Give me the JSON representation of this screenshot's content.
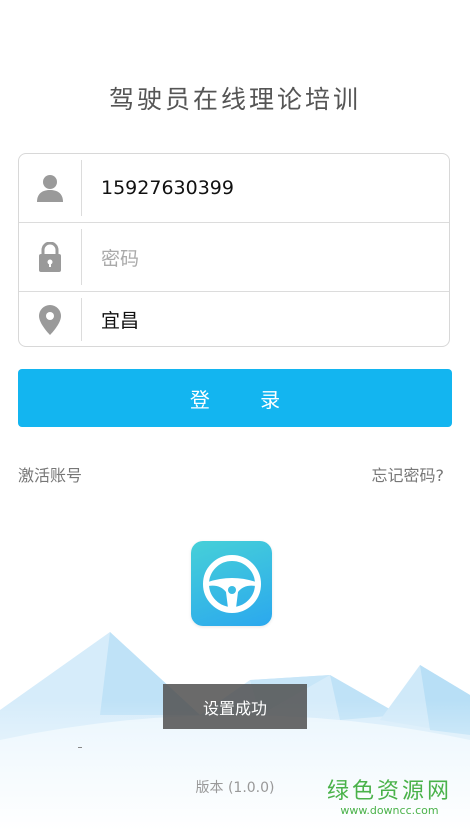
{
  "app": {
    "title": "驾驶员在线理论培训"
  },
  "form": {
    "phone": {
      "value": "15927630399",
      "icon": "user-icon"
    },
    "password": {
      "value": "",
      "placeholder": "密码",
      "icon": "lock-icon"
    },
    "city": {
      "value": "宜昌",
      "icon": "location-pin-icon"
    }
  },
  "login": {
    "label": "登 录",
    "color": "#13b5f0"
  },
  "links": {
    "activate": "激活账号",
    "forgot": "忘记密码?"
  },
  "logo": {
    "icon": "steering-wheel-icon"
  },
  "toast": {
    "message": "设置成功"
  },
  "footer": {
    "version": "版本  (1.0.0)"
  },
  "watermark": {
    "brand": "绿色资源网",
    "url": "www.downcc.com",
    "color": "#4ab24a"
  }
}
